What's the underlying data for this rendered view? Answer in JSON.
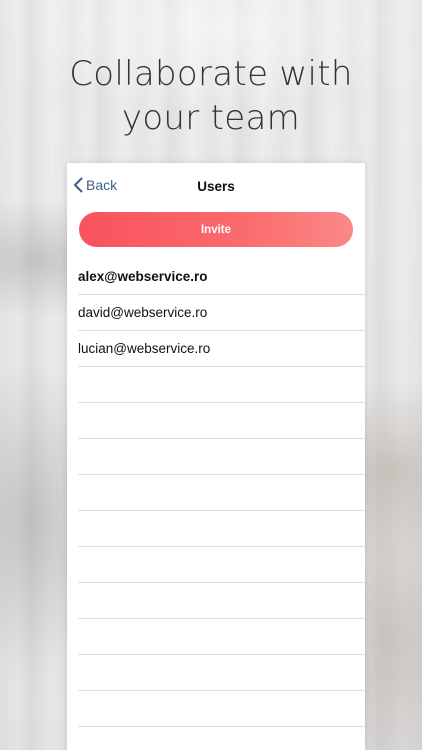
{
  "headline": {
    "line1": "Collaborate with",
    "line2": "your team"
  },
  "nav": {
    "back_label": "Back",
    "title": "Users"
  },
  "invite_button": {
    "label": "Invite"
  },
  "users": [
    {
      "email": "alex@webservice.ro",
      "selected": true
    },
    {
      "email": "david@webservice.ro",
      "selected": false
    },
    {
      "email": "lucian@webservice.ro",
      "selected": false
    }
  ],
  "empty_row_count": 11,
  "colors": {
    "accent": "#3e5e8c",
    "invite_gradient_start": "#f9525c",
    "invite_gradient_end": "#f98987"
  },
  "icons": {
    "back": "chevron-left-icon"
  }
}
